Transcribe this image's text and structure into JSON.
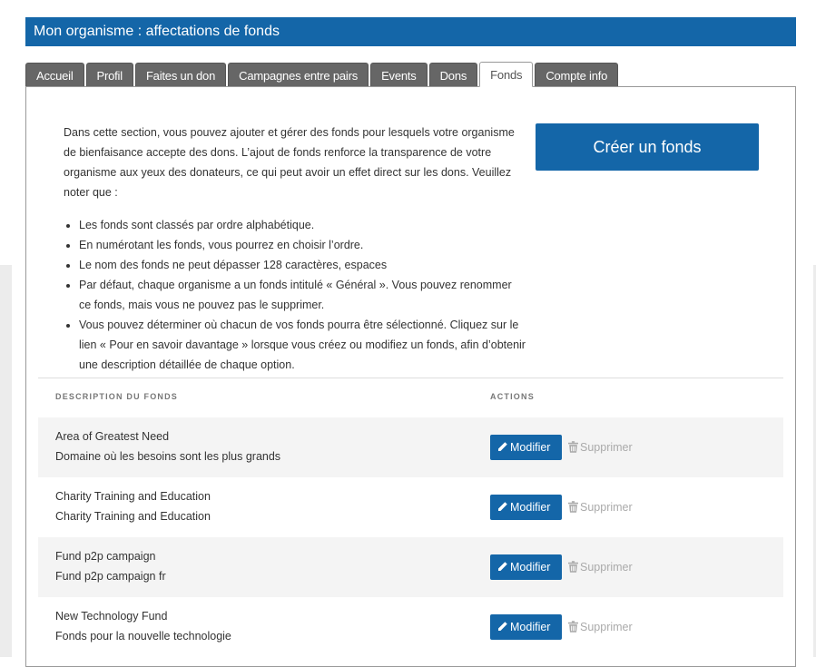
{
  "header": {
    "title": "Mon organisme : affectations de fonds"
  },
  "tabs": [
    {
      "label": "Accueil",
      "active": false
    },
    {
      "label": "Profil",
      "active": false
    },
    {
      "label": "Faites un don",
      "active": false
    },
    {
      "label": "Campagnes entre pairs",
      "active": false
    },
    {
      "label": "Events",
      "active": false
    },
    {
      "label": "Dons",
      "active": false
    },
    {
      "label": "Fonds",
      "active": true
    },
    {
      "label": "Compte info",
      "active": false
    }
  ],
  "intro": {
    "paragraph": "Dans cette section, vous pouvez ajouter et gérer des fonds pour lesquels votre organisme de bienfaisance accepte des dons. L’ajout de fonds renforce la transparence de votre organisme aux yeux des donateurs, ce qui peut avoir un effet direct sur les dons. Veuillez noter que :",
    "bullets": [
      "Les fonds sont classés par ordre alphabétique.",
      "En numérotant les fonds, vous pourrez en choisir l’ordre.",
      "Le nom des fonds ne peut dépasser 128 caractères, espaces",
      "Par défaut, chaque organisme a un fonds intitulé « Général ». Vous pouvez renommer ce fonds, mais vous ne pouvez pas le supprimer.",
      "Vous pouvez déterminer où chacun de vos fonds pourra être sélectionné. Cliquez sur le lien « Pour en savoir davantage » lorsque vous créez ou modifiez un fonds, afin d’obtenir une description détaillée de chaque option."
    ]
  },
  "create_button": {
    "label": "Créer un fonds"
  },
  "table": {
    "headers": {
      "description": "DESCRIPTION DU FONDS",
      "actions": "ACTIONS"
    },
    "rows": [
      {
        "name": "Area of Greatest Need",
        "name_fr": "Domaine où les besoins sont les plus grands"
      },
      {
        "name": "Charity Training and Education",
        "name_fr": "Charity Training and Education"
      },
      {
        "name": "Fund p2p campaign",
        "name_fr": "Fund p2p campaign fr"
      },
      {
        "name": "New Technology Fund",
        "name_fr": "Fonds pour la nouvelle technologie"
      }
    ],
    "edit_label": "Modifier",
    "delete_label": "Supprimer"
  },
  "icons": {
    "edit": "pencil-icon",
    "delete": "trash-icon"
  },
  "colors": {
    "primary": "#1466a8",
    "tab_inactive": "#666666",
    "row_alt": "#f4f4f4",
    "disabled_text": "#aaaaaa"
  }
}
